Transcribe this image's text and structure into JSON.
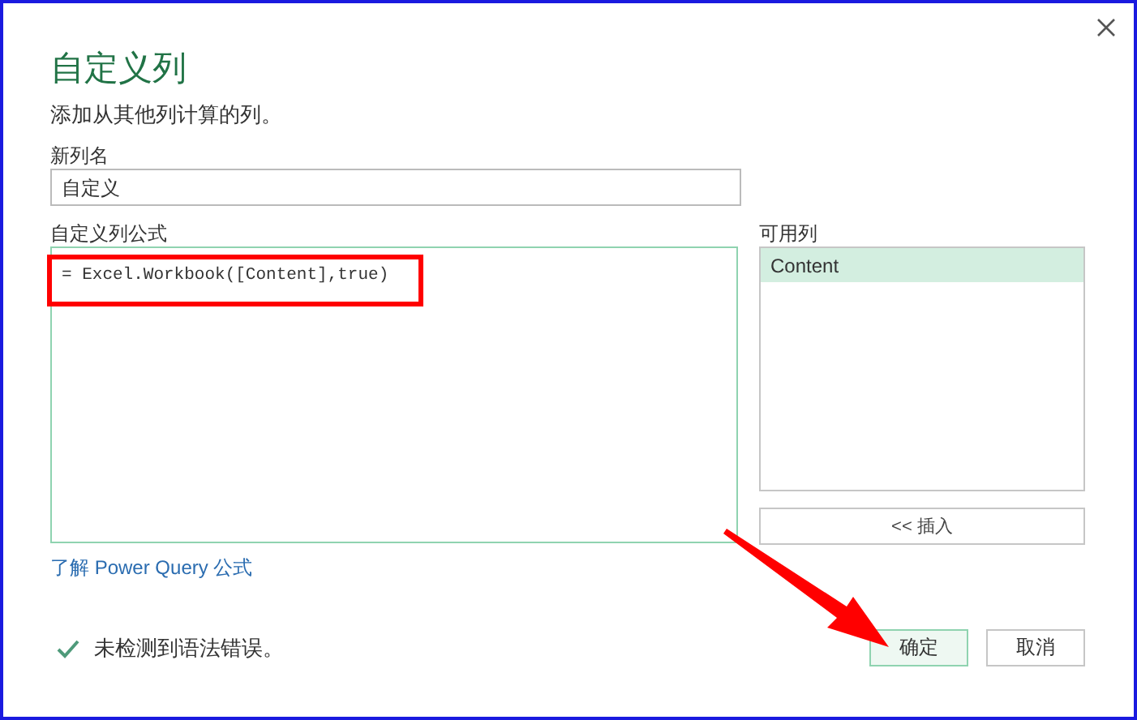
{
  "dialog": {
    "title": "自定义列",
    "subtitle": "添加从其他列计算的列。"
  },
  "new_column_name": {
    "label": "新列名",
    "value": "自定义"
  },
  "formula": {
    "label": "自定义列公式",
    "value": "= Excel.Workbook([Content],true)"
  },
  "available_columns": {
    "label": "可用列",
    "items": [
      {
        "label": "Content",
        "selected": true
      }
    ],
    "insert_button": "<< 插入"
  },
  "help_link": "了解 Power Query 公式",
  "status": {
    "ok": true,
    "text": "未检测到语法错误。"
  },
  "buttons": [
    {
      "label": "确定",
      "kind": "primary"
    },
    {
      "label": "取消",
      "kind": "secondary"
    }
  ],
  "annotations": {
    "highlight_box": true,
    "arrow": true
  }
}
